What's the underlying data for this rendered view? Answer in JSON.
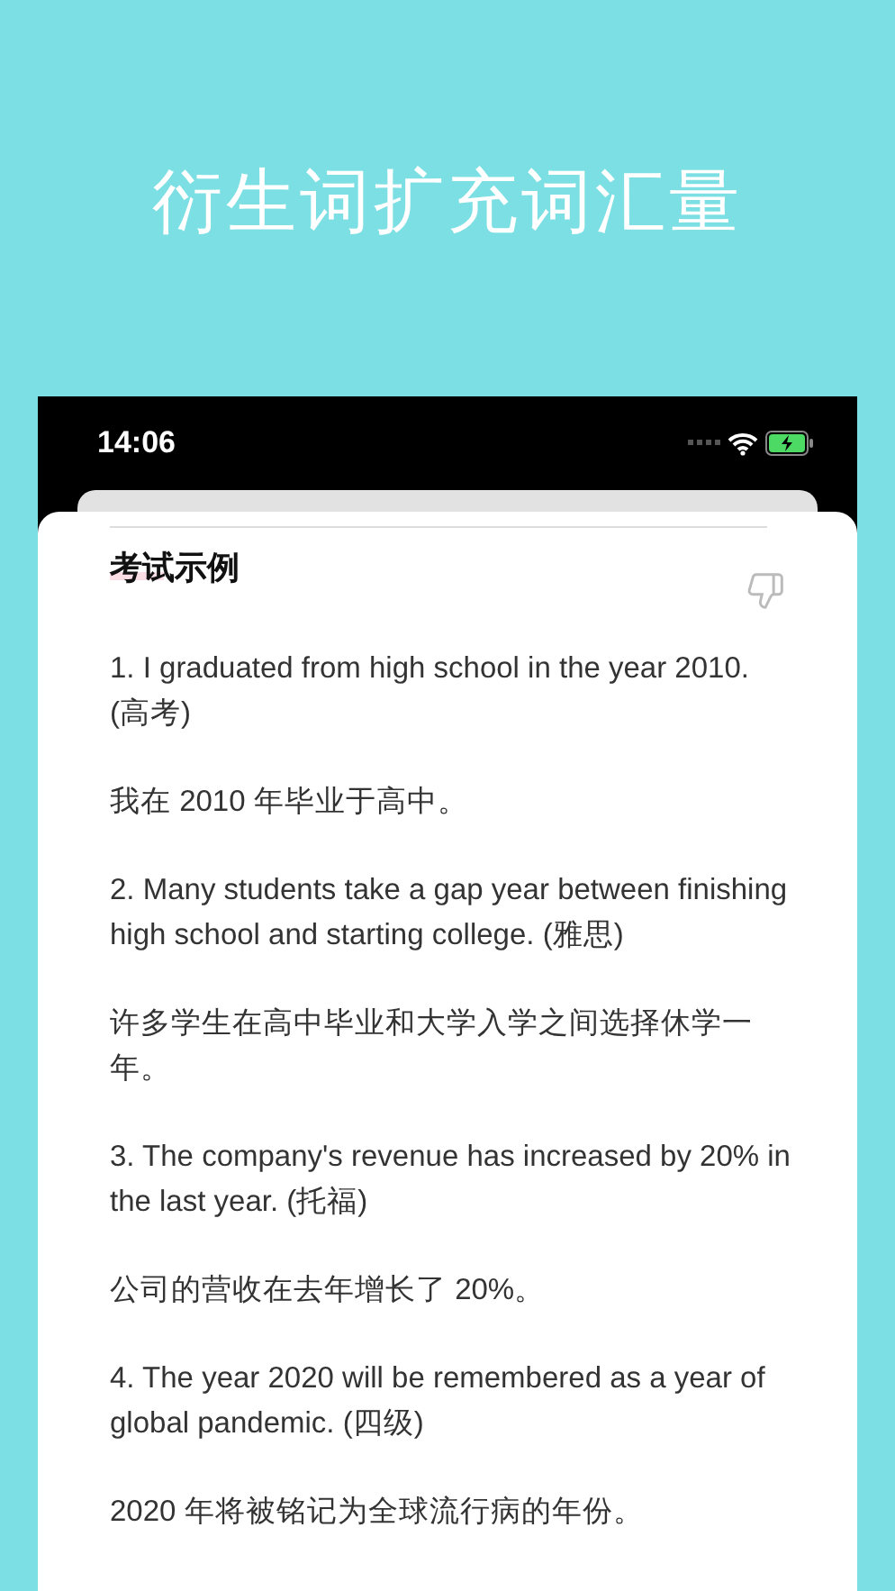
{
  "headline": "衍生词扩充词汇量",
  "status_bar": {
    "time": "14:06",
    "battery_charging": true
  },
  "card": {
    "title": "考试示例",
    "examples": [
      {
        "english": "1. I graduated from high school in the year 2010. (高考)",
        "chinese": "我在 2010 年毕业于高中。"
      },
      {
        "english": "2. Many students take a gap year between finishing high school and starting college. (雅思)",
        "chinese": "许多学生在高中毕业和大学入学之间选择休学一年。"
      },
      {
        "english": "3. The company's revenue has increased by 20% in the last year. (托福)",
        "chinese": "公司的营收在去年增长了 20%。"
      },
      {
        "english": "4. The year 2020 will be remembered as a year of global pandemic. (四级)",
        "chinese": "2020 年将被铭记为全球流行病的年份。"
      }
    ]
  }
}
